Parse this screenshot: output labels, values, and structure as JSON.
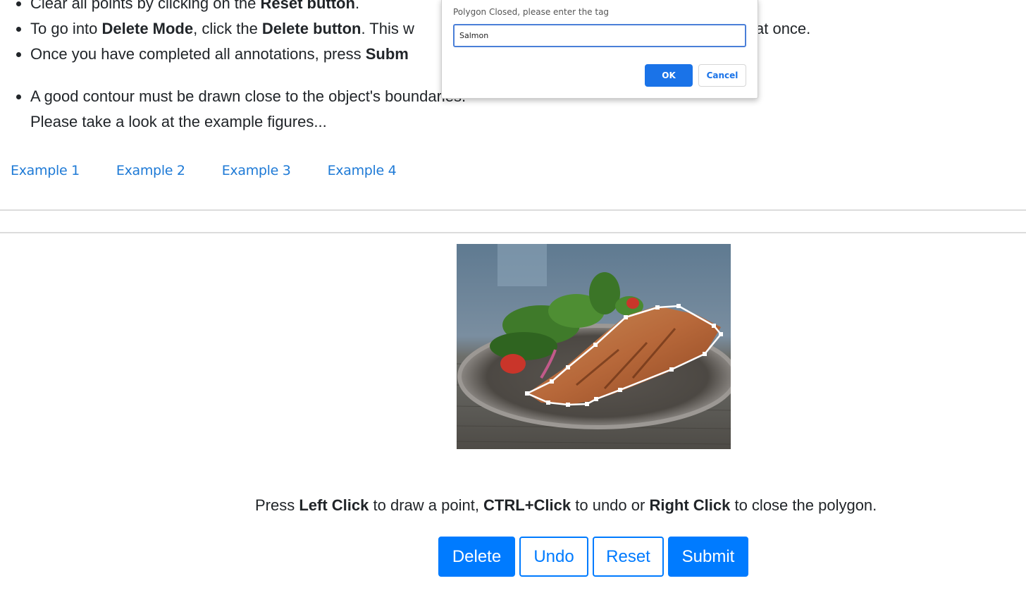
{
  "instructions": {
    "reset": {
      "prefix": "Clear all points by clicking on the ",
      "bold": "Reset button",
      "suffix": "."
    },
    "delete": {
      "prefix": "To go into ",
      "bold1": "Delete Mode",
      "middle": ", click the ",
      "bold2": "Delete button",
      "suffix_before_dialog": ". This w",
      "suffix_after_dialog": "at once."
    },
    "submit": {
      "prefix": "Once you have completed all annotations, press ",
      "bold": "Subm"
    },
    "contour": {
      "line1": "A good contour must be drawn close to the object's boundaries.",
      "line2": "Please take a look at the example figures..."
    }
  },
  "examples": [
    "Example 1",
    "Example 2",
    "Example 3",
    "Example 4"
  ],
  "image": {
    "icon": "salmon-plate-photo"
  },
  "help": {
    "press": "Press ",
    "left_click": "Left Click",
    "draw": " to draw a point, ",
    "ctrl_click": "CTRL+Click",
    "undo": " to undo or ",
    "right_click": "Right Click",
    "close": " to close the polygon."
  },
  "buttons": {
    "delete": "Delete",
    "undo": "Undo",
    "reset": "Reset",
    "submit": "Submit"
  },
  "dialog": {
    "message": "Polygon Closed, please enter the tag",
    "input_value": "Salmon",
    "ok": "OK",
    "cancel": "Cancel"
  },
  "colors": {
    "link": "#1e7ad6",
    "primary": "#007bff",
    "dialog_primary": "#1a73e8"
  }
}
